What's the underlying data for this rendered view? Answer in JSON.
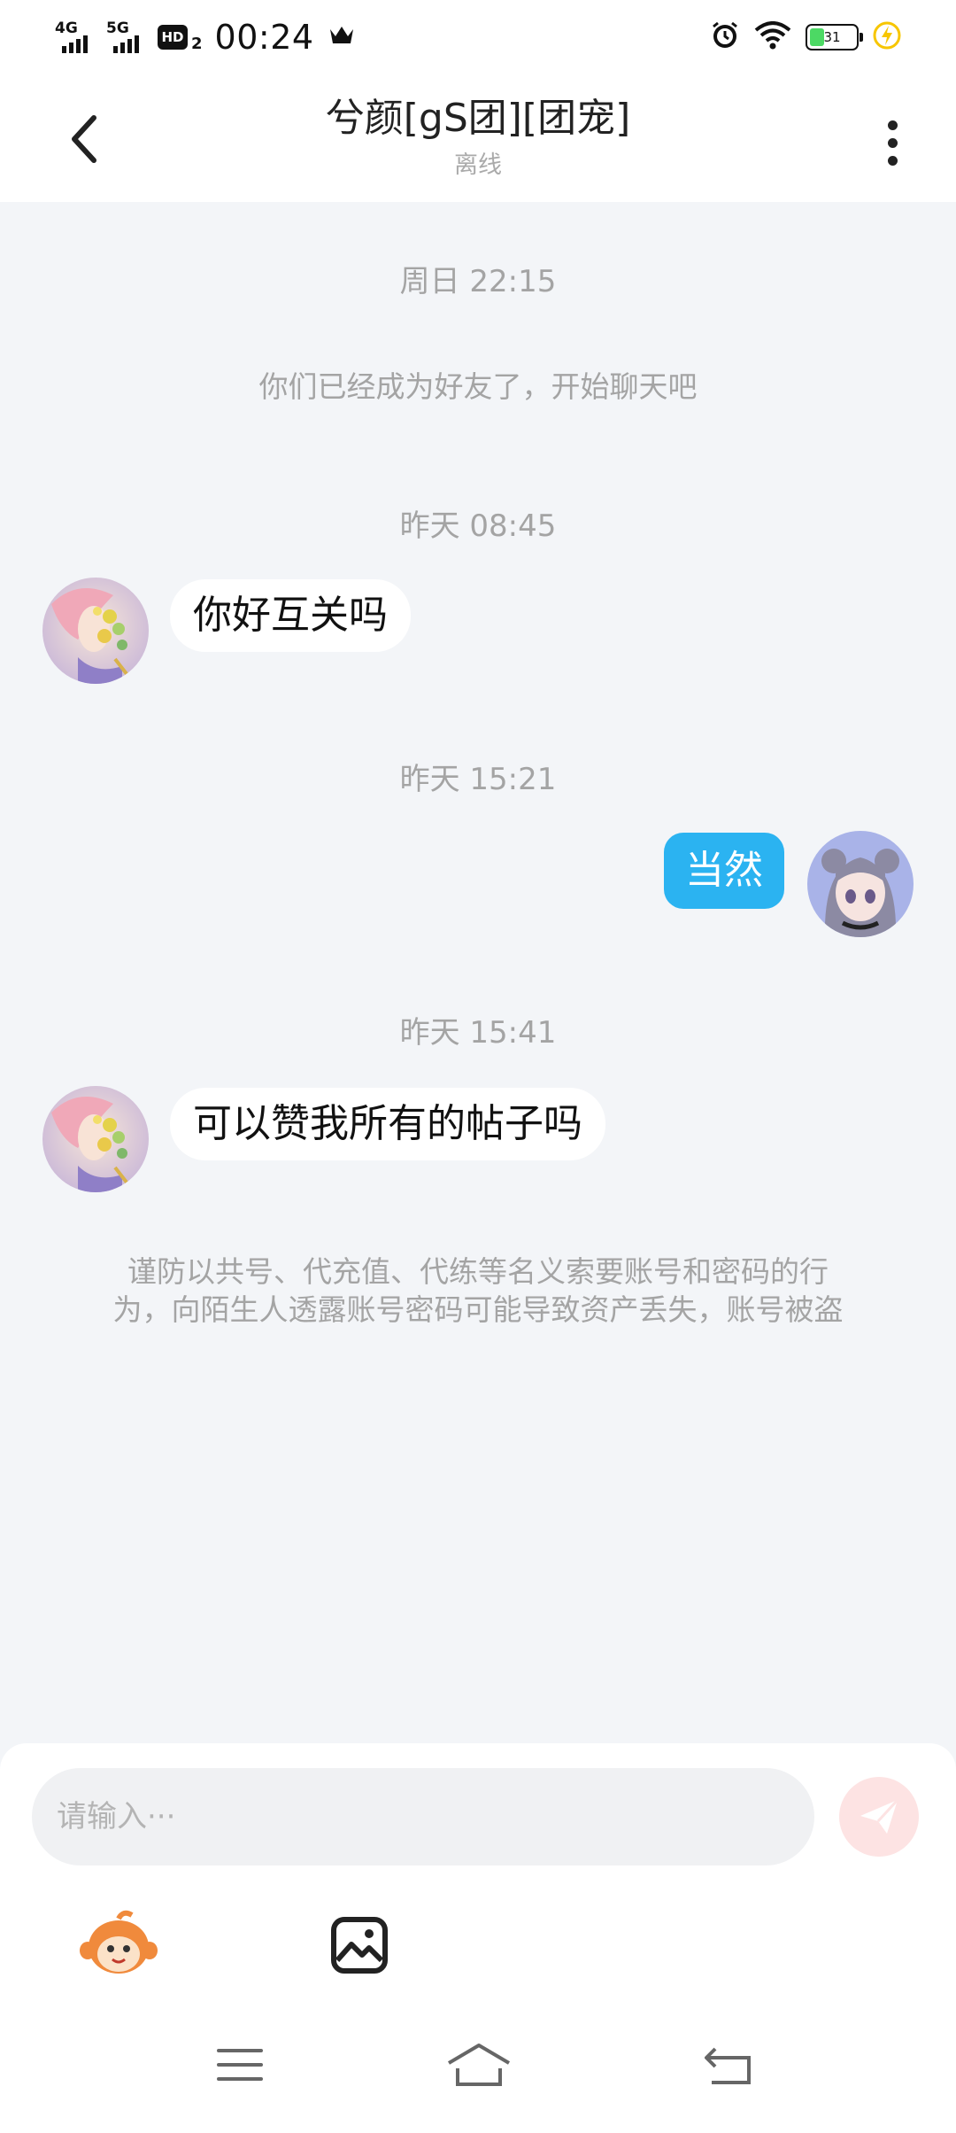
{
  "status_bar": {
    "network1": "4G",
    "network2": "5G",
    "hd_label": "HD",
    "hd_sub": "2",
    "time": "00:24",
    "battery_level": "31",
    "battery_fill": 0.31,
    "accent_green": "#4cd964",
    "charging_color": "#f7c600"
  },
  "header": {
    "title": "兮颜[gS团][团宠]",
    "subtitle": "离线",
    "back_icon": "chevron-left-icon",
    "more_icon": "more-vertical-icon"
  },
  "chat": {
    "timestamps": [
      "周日 22:15",
      "昨天 08:45",
      "昨天 15:21",
      "昨天 15:41"
    ],
    "system_message": "你们已经成为好友了，开始聊天吧",
    "messages": [
      {
        "from": "other",
        "text": "你好互关吗"
      },
      {
        "from": "self",
        "text": "当然"
      },
      {
        "from": "other",
        "text": "可以赞我所有的帖子吗"
      }
    ],
    "warning_line1": "谨防以共号、代充值、代练等名义索要账号和密码的行",
    "warning_line2": "为，向陌生人透露账号密码可能导致资产丢失，账号被盗"
  },
  "input": {
    "placeholder": "请输入···",
    "value": "",
    "send_icon": "send-icon",
    "emoji_icon": "monkey-sticker-icon",
    "image_icon": "image-icon"
  },
  "nav": {
    "menu_icon": "menu-icon",
    "home_icon": "home-icon",
    "back_icon": "back-icon"
  },
  "colors": {
    "bubble_self": "#2bb3f1",
    "bubble_other": "#ffffff",
    "background": "#f3f5f8",
    "send_button": "#fde3e3"
  }
}
